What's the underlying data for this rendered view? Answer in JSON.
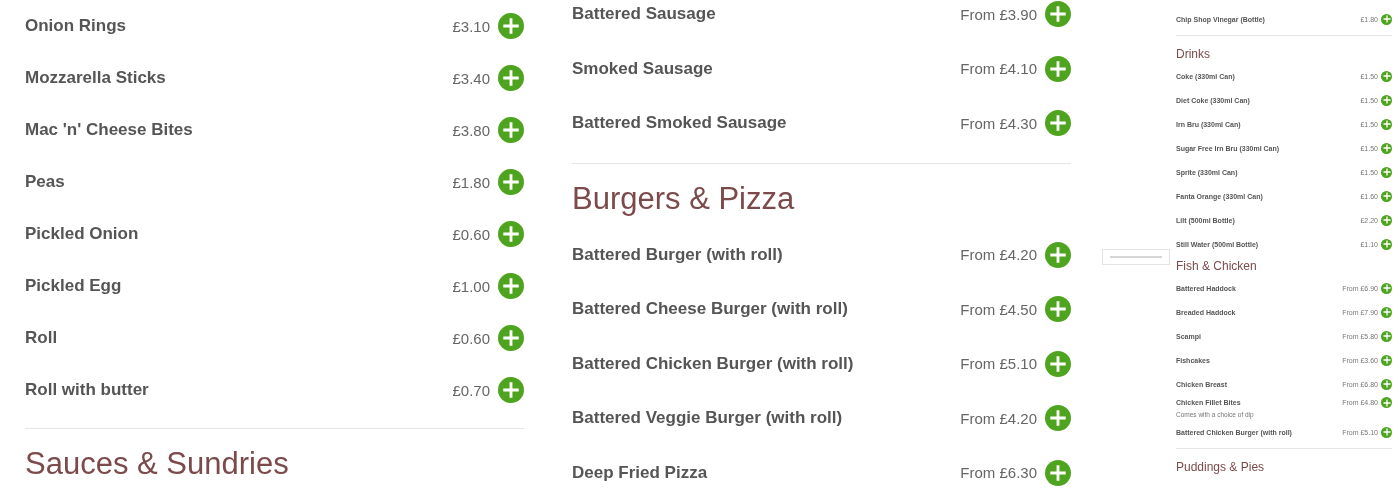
{
  "columns": [
    {
      "blocks": [
        {
          "kind": "item",
          "name": "Onion Rings",
          "price": "£3.10"
        },
        {
          "kind": "item",
          "name": "Mozzarella Sticks",
          "price": "£3.40"
        },
        {
          "kind": "item",
          "name": "Mac 'n' Cheese Bites",
          "price": "£3.80"
        },
        {
          "kind": "item",
          "name": "Peas",
          "price": "£1.80"
        },
        {
          "kind": "item",
          "name": "Pickled Onion",
          "price": "£0.60"
        },
        {
          "kind": "item",
          "name": "Pickled Egg",
          "price": "£1.00"
        },
        {
          "kind": "item",
          "name": "Roll",
          "price": "£0.60"
        },
        {
          "kind": "item",
          "name": "Roll with butter",
          "price": "£0.70"
        },
        {
          "kind": "divider"
        },
        {
          "kind": "heading",
          "text": "Sauces & Sundries"
        }
      ]
    },
    {
      "blocks": [
        {
          "kind": "item",
          "name": "Battered Sausage",
          "price": "From £3.90"
        },
        {
          "kind": "item",
          "name": "Smoked Sausage",
          "price": "From £4.10"
        },
        {
          "kind": "item",
          "name": "Battered Smoked Sausage",
          "price": "From £4.30"
        },
        {
          "kind": "divider"
        },
        {
          "kind": "heading",
          "text": "Burgers & Pizza"
        },
        {
          "kind": "item",
          "name": "Battered Burger (with roll)",
          "price": "From £4.20"
        },
        {
          "kind": "item",
          "name": "Battered Cheese Burger (with roll)",
          "price": "From £4.50"
        },
        {
          "kind": "item",
          "name": "Battered Chicken Burger (with roll)",
          "price": "From £5.10"
        },
        {
          "kind": "item",
          "name": "Battered Veggie Burger (with roll)",
          "price": "From £4.20"
        },
        {
          "kind": "item",
          "name": "Deep Fried Pizza",
          "price": "From £6.30"
        }
      ]
    },
    {
      "blocks": [
        {
          "kind": "item",
          "name": "Chip Shop Vinegar (Bottle)",
          "price": "£1.80"
        },
        {
          "kind": "divider"
        },
        {
          "kind": "heading",
          "text": "Drinks"
        },
        {
          "kind": "item",
          "name": "Coke (330ml Can)",
          "price": "£1.50"
        },
        {
          "kind": "item",
          "name": "Diet Coke (330ml Can)",
          "price": "£1.50"
        },
        {
          "kind": "item",
          "name": "Irn Bru (330ml Can)",
          "price": "£1.50"
        },
        {
          "kind": "item",
          "name": "Sugar Free Irn Bru (330ml Can)",
          "price": "£1.50"
        },
        {
          "kind": "item",
          "name": "Sprite (330ml Can)",
          "price": "£1.50"
        },
        {
          "kind": "item",
          "name": "Fanta Orange (330ml Can)",
          "price": "£1.60"
        },
        {
          "kind": "item",
          "name": "Lilt (500ml Bottle)",
          "price": "£2.20"
        },
        {
          "kind": "item",
          "name": "Still Water (500ml Bottle)",
          "price": "£1.10"
        },
        {
          "kind": "heading",
          "text": "Fish & Chicken"
        },
        {
          "kind": "item",
          "name": "Battered Haddock",
          "price": "From £6.90"
        },
        {
          "kind": "item",
          "name": "Breaded Haddock",
          "price": "From £7.90"
        },
        {
          "kind": "item",
          "name": "Scampi",
          "price": "From £5.80"
        },
        {
          "kind": "item",
          "name": "Fishcakes",
          "price": "From £3.60"
        },
        {
          "kind": "item",
          "name": "Chicken Breast",
          "price": "From £6.80"
        },
        {
          "kind": "item",
          "name": "Chicken Fillet Bites",
          "price": "From £4.80",
          "description": "Comes with a choice of dip"
        },
        {
          "kind": "item",
          "name": "Battered Chicken Burger (with roll)",
          "price": "From £5.10"
        },
        {
          "kind": "divider"
        },
        {
          "kind": "heading",
          "text": "Puddings & Pies"
        }
      ]
    }
  ]
}
